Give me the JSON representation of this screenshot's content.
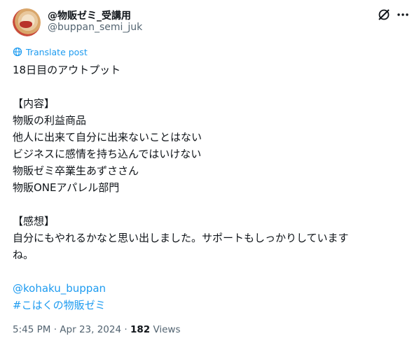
{
  "author": {
    "name": "@物販ゼミ_受講用",
    "handle": "@buppan_semi_juk"
  },
  "translate_label": "Translate post",
  "post": {
    "line1": "18日目のアウトプット",
    "section1_heading": "【内容】",
    "content_items": [
      "物販の利益商品",
      "他人に出来て自分に出来ないことはない",
      "ビジネスに感情を持ち込んではいけない",
      "物販ゼミ卒業生あずささん",
      "物販ONEアパレル部門"
    ],
    "section2_heading": "【感想】",
    "impression_line1": "自分にもやれるかなと思い出しました。サポートもしっかりしています",
    "impression_line2": "ね。",
    "mention": "@kohaku_buppan",
    "hashtag": "#こはくの物販ゼミ"
  },
  "meta": {
    "time": "5:45 PM",
    "separator1": "·",
    "date": "Apr 23, 2024",
    "separator2": "·",
    "views_count": "182",
    "views_label": "Views"
  },
  "icons": {
    "grok": "grok-icon",
    "more": "more-icon",
    "translate": "translate-globe-icon"
  },
  "colors": {
    "link": "#1d9bf0",
    "secondary_text": "#536471",
    "primary_text": "#0f1419"
  }
}
